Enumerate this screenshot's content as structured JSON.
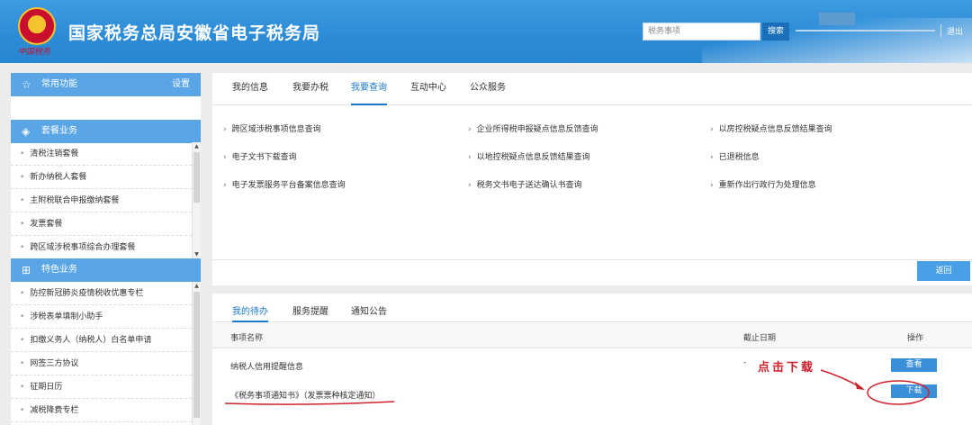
{
  "header": {
    "site_title": "国家税务总局安徽省电子税务局",
    "emblem_caption": "中国税务",
    "search_placeholder": "税务事项",
    "search_button": "搜索",
    "logout": "退出"
  },
  "sidebar": {
    "common": {
      "label": "常用功能",
      "setting": "设置"
    },
    "packages": {
      "label": "套餐业务",
      "items": [
        "清税注销套餐",
        "新办纳税人套餐",
        "主附税联合申报缴纳套餐",
        "发票套餐",
        "跨区域涉税事项综合办理套餐"
      ]
    },
    "features": {
      "label": "特色业务",
      "items": [
        "防控新冠肺炎疫情税收优惠专栏",
        "涉税表单填制小助手",
        "扣缴义务人（纳税人）白名单申请",
        "网签三方协议",
        "征期日历",
        "减税降费专栏"
      ]
    }
  },
  "main": {
    "tabs": [
      "我的信息",
      "我要办税",
      "我要查询",
      "互动中心",
      "公众服务"
    ],
    "active_tab": "我要查询",
    "query_links": [
      [
        "跨区域涉税事项信息查询",
        "企业所得税申报疑点信息反馈查询",
        "以房控税疑点信息反馈结果查询"
      ],
      [
        "电子文书下载查询",
        "以地控税疑点信息反馈结果查询",
        "已退税信息"
      ],
      [
        "电子发票服务平台备案信息查询",
        "税务文书电子送达确认书查询",
        "重新作出行政行为处理信息"
      ]
    ],
    "back_button": "返回"
  },
  "todo": {
    "tabs": [
      "我的待办",
      "服务提醒",
      "通知公告"
    ],
    "active_tab": "我的待办",
    "columns": {
      "name": "事项名称",
      "deadline": "截止日期",
      "action": "操作"
    },
    "rows": [
      {
        "name": "纳税人信用提醒信息",
        "deadline": "-",
        "action": "查看"
      },
      {
        "name": "《税务事项通知书》（发票票种核定通知）",
        "deadline": "",
        "action": "下载"
      }
    ]
  },
  "annotation": {
    "text": "点击下载",
    "color": "#d0202a"
  },
  "colors": {
    "header_blue": "#2c8bd6",
    "accent": "#1c78c8",
    "button_blue": "#3a8fd9",
    "annotation_red": "#d0202a"
  }
}
